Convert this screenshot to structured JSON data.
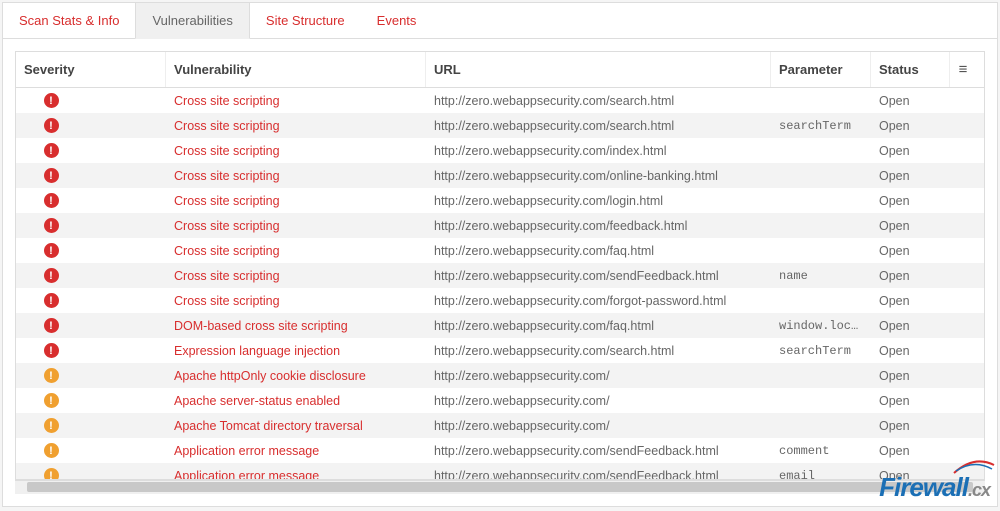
{
  "tabs": [
    {
      "label": "Scan Stats & Info",
      "active": false
    },
    {
      "label": "Vulnerabilities",
      "active": true
    },
    {
      "label": "Site Structure",
      "active": false
    },
    {
      "label": "Events",
      "active": false
    }
  ],
  "columns": {
    "severity": "Severity",
    "vulnerability": "Vulnerability",
    "url": "URL",
    "parameter": "Parameter",
    "status": "Status"
  },
  "menu_icon": "≡",
  "rows": [
    {
      "sev": "high",
      "vuln": "Cross site scripting",
      "url": "http://zero.webappsecurity.com/search.html",
      "param": "",
      "status": "Open"
    },
    {
      "sev": "high",
      "vuln": "Cross site scripting",
      "url": "http://zero.webappsecurity.com/search.html",
      "param": "searchTerm",
      "status": "Open"
    },
    {
      "sev": "high",
      "vuln": "Cross site scripting",
      "url": "http://zero.webappsecurity.com/index.html",
      "param": "",
      "status": "Open"
    },
    {
      "sev": "high",
      "vuln": "Cross site scripting",
      "url": "http://zero.webappsecurity.com/online-banking.html",
      "param": "",
      "status": "Open"
    },
    {
      "sev": "high",
      "vuln": "Cross site scripting",
      "url": "http://zero.webappsecurity.com/login.html",
      "param": "",
      "status": "Open"
    },
    {
      "sev": "high",
      "vuln": "Cross site scripting",
      "url": "http://zero.webappsecurity.com/feedback.html",
      "param": "",
      "status": "Open"
    },
    {
      "sev": "high",
      "vuln": "Cross site scripting",
      "url": "http://zero.webappsecurity.com/faq.html",
      "param": "",
      "status": "Open"
    },
    {
      "sev": "high",
      "vuln": "Cross site scripting",
      "url": "http://zero.webappsecurity.com/sendFeedback.html",
      "param": "name",
      "status": "Open"
    },
    {
      "sev": "high",
      "vuln": "Cross site scripting",
      "url": "http://zero.webappsecurity.com/forgot-password.html",
      "param": "",
      "status": "Open"
    },
    {
      "sev": "high",
      "vuln": "DOM-based cross site scripting",
      "url": "http://zero.webappsecurity.com/faq.html",
      "param": "window.location",
      "status": "Open"
    },
    {
      "sev": "high",
      "vuln": "Expression language injection",
      "url": "http://zero.webappsecurity.com/search.html",
      "param": "searchTerm",
      "status": "Open"
    },
    {
      "sev": "med",
      "vuln": "Apache httpOnly cookie disclosure",
      "url": "http://zero.webappsecurity.com/",
      "param": "",
      "status": "Open"
    },
    {
      "sev": "med",
      "vuln": "Apache server-status enabled",
      "url": "http://zero.webappsecurity.com/",
      "param": "",
      "status": "Open"
    },
    {
      "sev": "med",
      "vuln": "Apache Tomcat directory traversal",
      "url": "http://zero.webappsecurity.com/",
      "param": "",
      "status": "Open"
    },
    {
      "sev": "med",
      "vuln": "Application error message",
      "url": "http://zero.webappsecurity.com/sendFeedback.html",
      "param": "comment",
      "status": "Open"
    },
    {
      "sev": "med",
      "vuln": "Application error message",
      "url": "http://zero.webappsecurity.com/sendFeedback.html",
      "param": "email",
      "status": "Open"
    }
  ],
  "watermark": {
    "brand": "Firewall",
    "tld": ".cx"
  }
}
